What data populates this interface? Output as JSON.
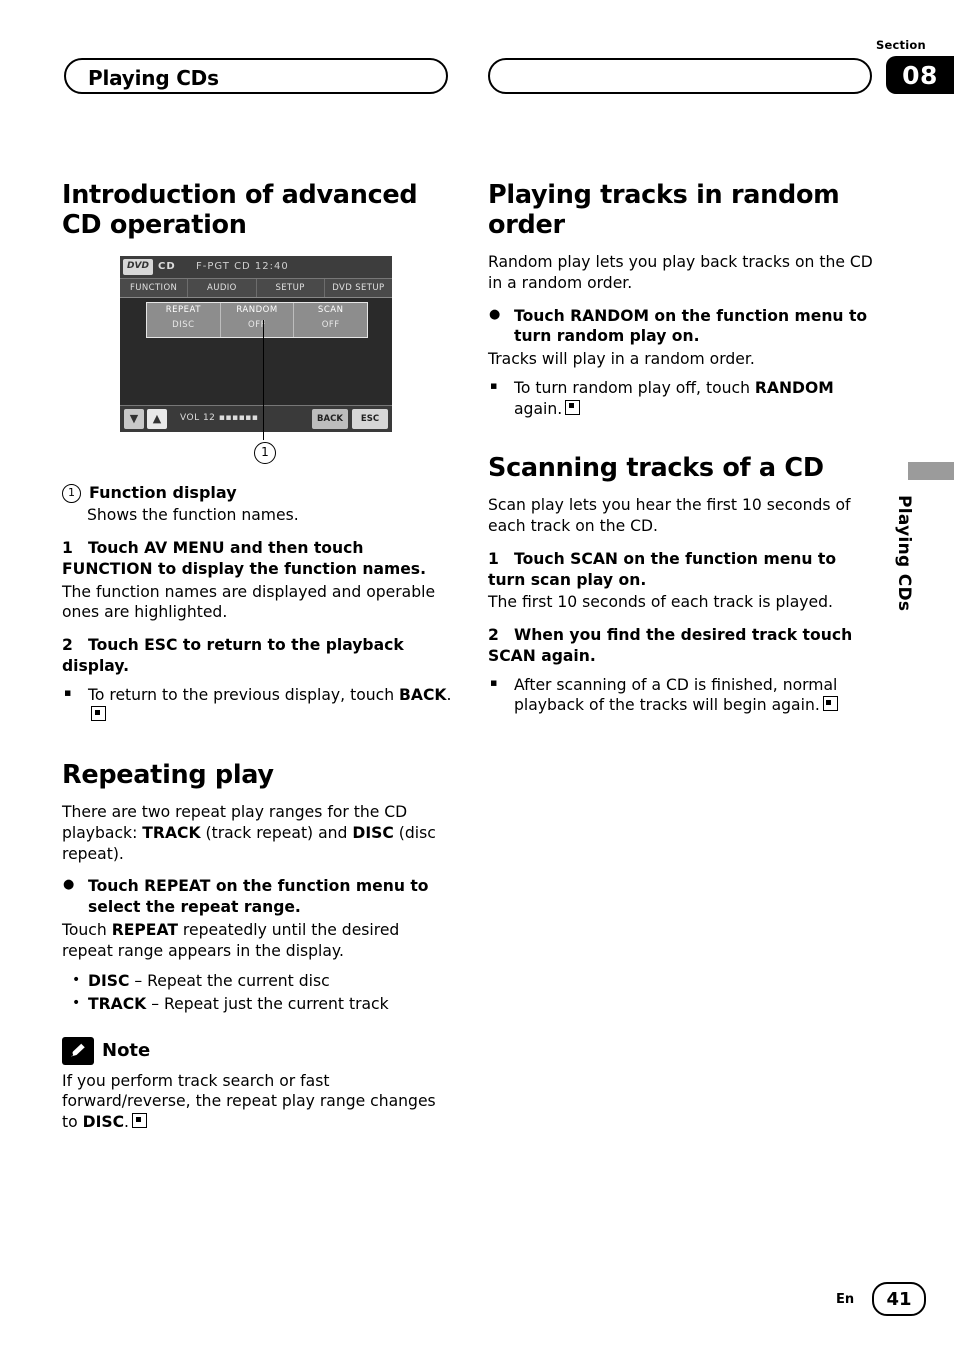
{
  "header": {
    "section_label": "Section",
    "section_number": "08",
    "left_title": "Playing CDs",
    "right_title": ""
  },
  "side_tab": {
    "label": "Playing CDs"
  },
  "left_column": {
    "headline": "Introduction of advanced CD operation",
    "figure": {
      "dvd_badge": "DVD",
      "cd_badge": "CD",
      "track_text": "F-PGT CD 12:40",
      "menu_items": [
        "FUNCTION",
        "AUDIO",
        "SETUP",
        "DVD SETUP"
      ],
      "function_cells": [
        {
          "label": "REPEAT",
          "value": "DISC"
        },
        {
          "label": "RANDOM",
          "value": "OFF"
        },
        {
          "label": "SCAN",
          "value": "OFF"
        }
      ],
      "arrow_down": "▼",
      "arrow_up": "▲",
      "volume_text": "VOL 12 ▪▪▪▪▪▪",
      "back_button": "BACK",
      "esc_button": "ESC",
      "callout_number": "1"
    },
    "legend": {
      "number": "1",
      "title": "Function display",
      "description": "Shows the function names."
    },
    "step1": {
      "num": "1",
      "text": "Touch AV MENU and then touch FUNCTION to display the function names.",
      "body": "The function names are displayed and operable ones are highlighted."
    },
    "step2": {
      "num": "2",
      "text": "Touch ESC to return to the playback display.",
      "sub_prefix": "To return to the previous display, touch ",
      "sub_bold": "BACK",
      "sub_suffix": "."
    },
    "repeating": {
      "headline": "Repeating play",
      "intro_1": "There are two repeat play ranges for the CD playback: ",
      "intro_bold_1": "TRACK",
      "intro_2": " (track repeat) and ",
      "intro_bold_2": "DISC",
      "intro_3": " (disc repeat).",
      "bullet": "Touch REPEAT on the function menu to select the repeat range.",
      "body_1": "Touch ",
      "body_bold": "REPEAT",
      "body_2": " repeatedly until the desired repeat range appears in the display.",
      "items": [
        {
          "bold": "DISC",
          "rest": " – Repeat the current disc"
        },
        {
          "bold": "TRACK",
          "rest": " – Repeat just the current track"
        }
      ],
      "note_title": "Note",
      "note_1": "If you perform track search or fast forward/reverse, the repeat play range changes to ",
      "note_bold": "DISC",
      "note_2": "."
    }
  },
  "right_column": {
    "random": {
      "headline": "Playing tracks in random order",
      "intro": "Random play lets you play back tracks on the CD in a random order.",
      "bullet": "Touch RANDOM on the function menu to turn random play on.",
      "body": "Tracks will play in a random order.",
      "sub_prefix": "To turn random play off, touch ",
      "sub_bold": "RANDOM",
      "sub_suffix": " again."
    },
    "scanning": {
      "headline": "Scanning tracks of a CD",
      "intro": "Scan play lets you hear the first 10 seconds of each track on the CD.",
      "step1_num": "1",
      "step1": "Touch SCAN on the function menu to turn scan play on.",
      "step1_body": "The first 10 seconds of each track is played.",
      "step2_num": "2",
      "step2": "When you find the desired track touch SCAN again.",
      "sub": "After scanning of a CD is finished, normal playback of the tracks will begin again."
    }
  },
  "footer": {
    "language": "En",
    "page": "41"
  }
}
